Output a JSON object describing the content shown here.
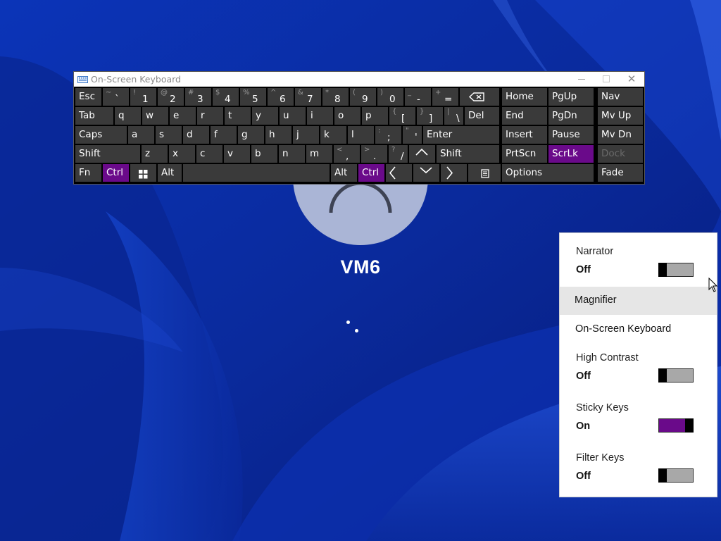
{
  "lock_screen": {
    "username": "VM6"
  },
  "osk": {
    "title": "On-Screen Keyboard",
    "close_label": "✕",
    "rows": [
      [
        {
          "label": "Esc"
        },
        {
          "shift": "~",
          "main": "`"
        },
        {
          "shift": "!",
          "main": "1"
        },
        {
          "shift": "@",
          "main": "2"
        },
        {
          "shift": "#",
          "main": "3"
        },
        {
          "shift": "$",
          "main": "4"
        },
        {
          "shift": "%",
          "main": "5"
        },
        {
          "shift": "^",
          "main": "6"
        },
        {
          "shift": "&",
          "main": "7"
        },
        {
          "shift": "*",
          "main": "8"
        },
        {
          "shift": "(",
          "main": "9"
        },
        {
          "shift": ")",
          "main": "0"
        },
        {
          "shift": "_",
          "main": "-"
        },
        {
          "shift": "+",
          "main": "="
        },
        {
          "icon": "backspace-icon"
        },
        {
          "label": "Home"
        },
        {
          "label": "PgUp"
        },
        {
          "label": "Nav"
        }
      ],
      [
        {
          "label": "Tab"
        },
        {
          "label": "q"
        },
        {
          "label": "w"
        },
        {
          "label": "e"
        },
        {
          "label": "r"
        },
        {
          "label": "t"
        },
        {
          "label": "y"
        },
        {
          "label": "u"
        },
        {
          "label": "i"
        },
        {
          "label": "o"
        },
        {
          "label": "p"
        },
        {
          "shift": "{",
          "main": "["
        },
        {
          "shift": "}",
          "main": "]"
        },
        {
          "shift": "|",
          "main": "\\"
        },
        {
          "label": "Del"
        },
        {
          "label": "End"
        },
        {
          "label": "PgDn"
        },
        {
          "label": "Mv Up"
        }
      ],
      [
        {
          "label": "Caps"
        },
        {
          "label": "a"
        },
        {
          "label": "s"
        },
        {
          "label": "d"
        },
        {
          "label": "f"
        },
        {
          "label": "g"
        },
        {
          "label": "h"
        },
        {
          "label": "j"
        },
        {
          "label": "k"
        },
        {
          "label": "l"
        },
        {
          "shift": ":",
          "main": ";"
        },
        {
          "shift": "\"",
          "main": "'"
        },
        {
          "label": "Enter"
        },
        {
          "label": "Insert"
        },
        {
          "label": "Pause"
        },
        {
          "label": "Mv Dn"
        }
      ],
      [
        {
          "label": "Shift"
        },
        {
          "label": "z"
        },
        {
          "label": "x"
        },
        {
          "label": "c"
        },
        {
          "label": "v"
        },
        {
          "label": "b"
        },
        {
          "label": "n"
        },
        {
          "label": "m"
        },
        {
          "shift": "<",
          "main": ","
        },
        {
          "shift": ">",
          "main": "."
        },
        {
          "shift": "?",
          "main": "/"
        },
        {
          "icon": "arrow-up-icon"
        },
        {
          "label": "Shift"
        },
        {
          "label": "PrtScn"
        },
        {
          "label": "ScrLk",
          "active": true
        },
        {
          "label": "Dock",
          "dim": true
        }
      ],
      [
        {
          "label": "Fn"
        },
        {
          "label": "Ctrl",
          "active": true
        },
        {
          "icon": "windows-logo-icon"
        },
        {
          "label": "Alt"
        },
        {
          "label": ""
        },
        {
          "label": "Alt"
        },
        {
          "label": "Ctrl",
          "active": true
        },
        {
          "icon": "arrow-left-icon"
        },
        {
          "icon": "arrow-down-icon"
        },
        {
          "icon": "arrow-right-icon"
        },
        {
          "icon": "menu-key-icon"
        },
        {
          "label": "Options"
        },
        {
          "label": "Fade"
        }
      ]
    ]
  },
  "accessibility_panel": {
    "items": [
      {
        "type": "toggle",
        "label": "Narrator",
        "state": "Off",
        "on": false
      },
      {
        "type": "link",
        "label": "Magnifier",
        "hovered": true
      },
      {
        "type": "link",
        "label": "On-Screen Keyboard"
      },
      {
        "type": "toggle",
        "label": "High Contrast",
        "state": "Off",
        "on": false
      },
      {
        "type": "toggle",
        "label": "Sticky Keys",
        "state": "On",
        "on": true
      },
      {
        "type": "toggle",
        "label": "Filter Keys",
        "state": "Off",
        "on": false
      }
    ]
  },
  "colors": {
    "accent": "#6a0a8a",
    "key_bg": "#3a3a3a",
    "wallpaper": "#0a2a9a"
  }
}
